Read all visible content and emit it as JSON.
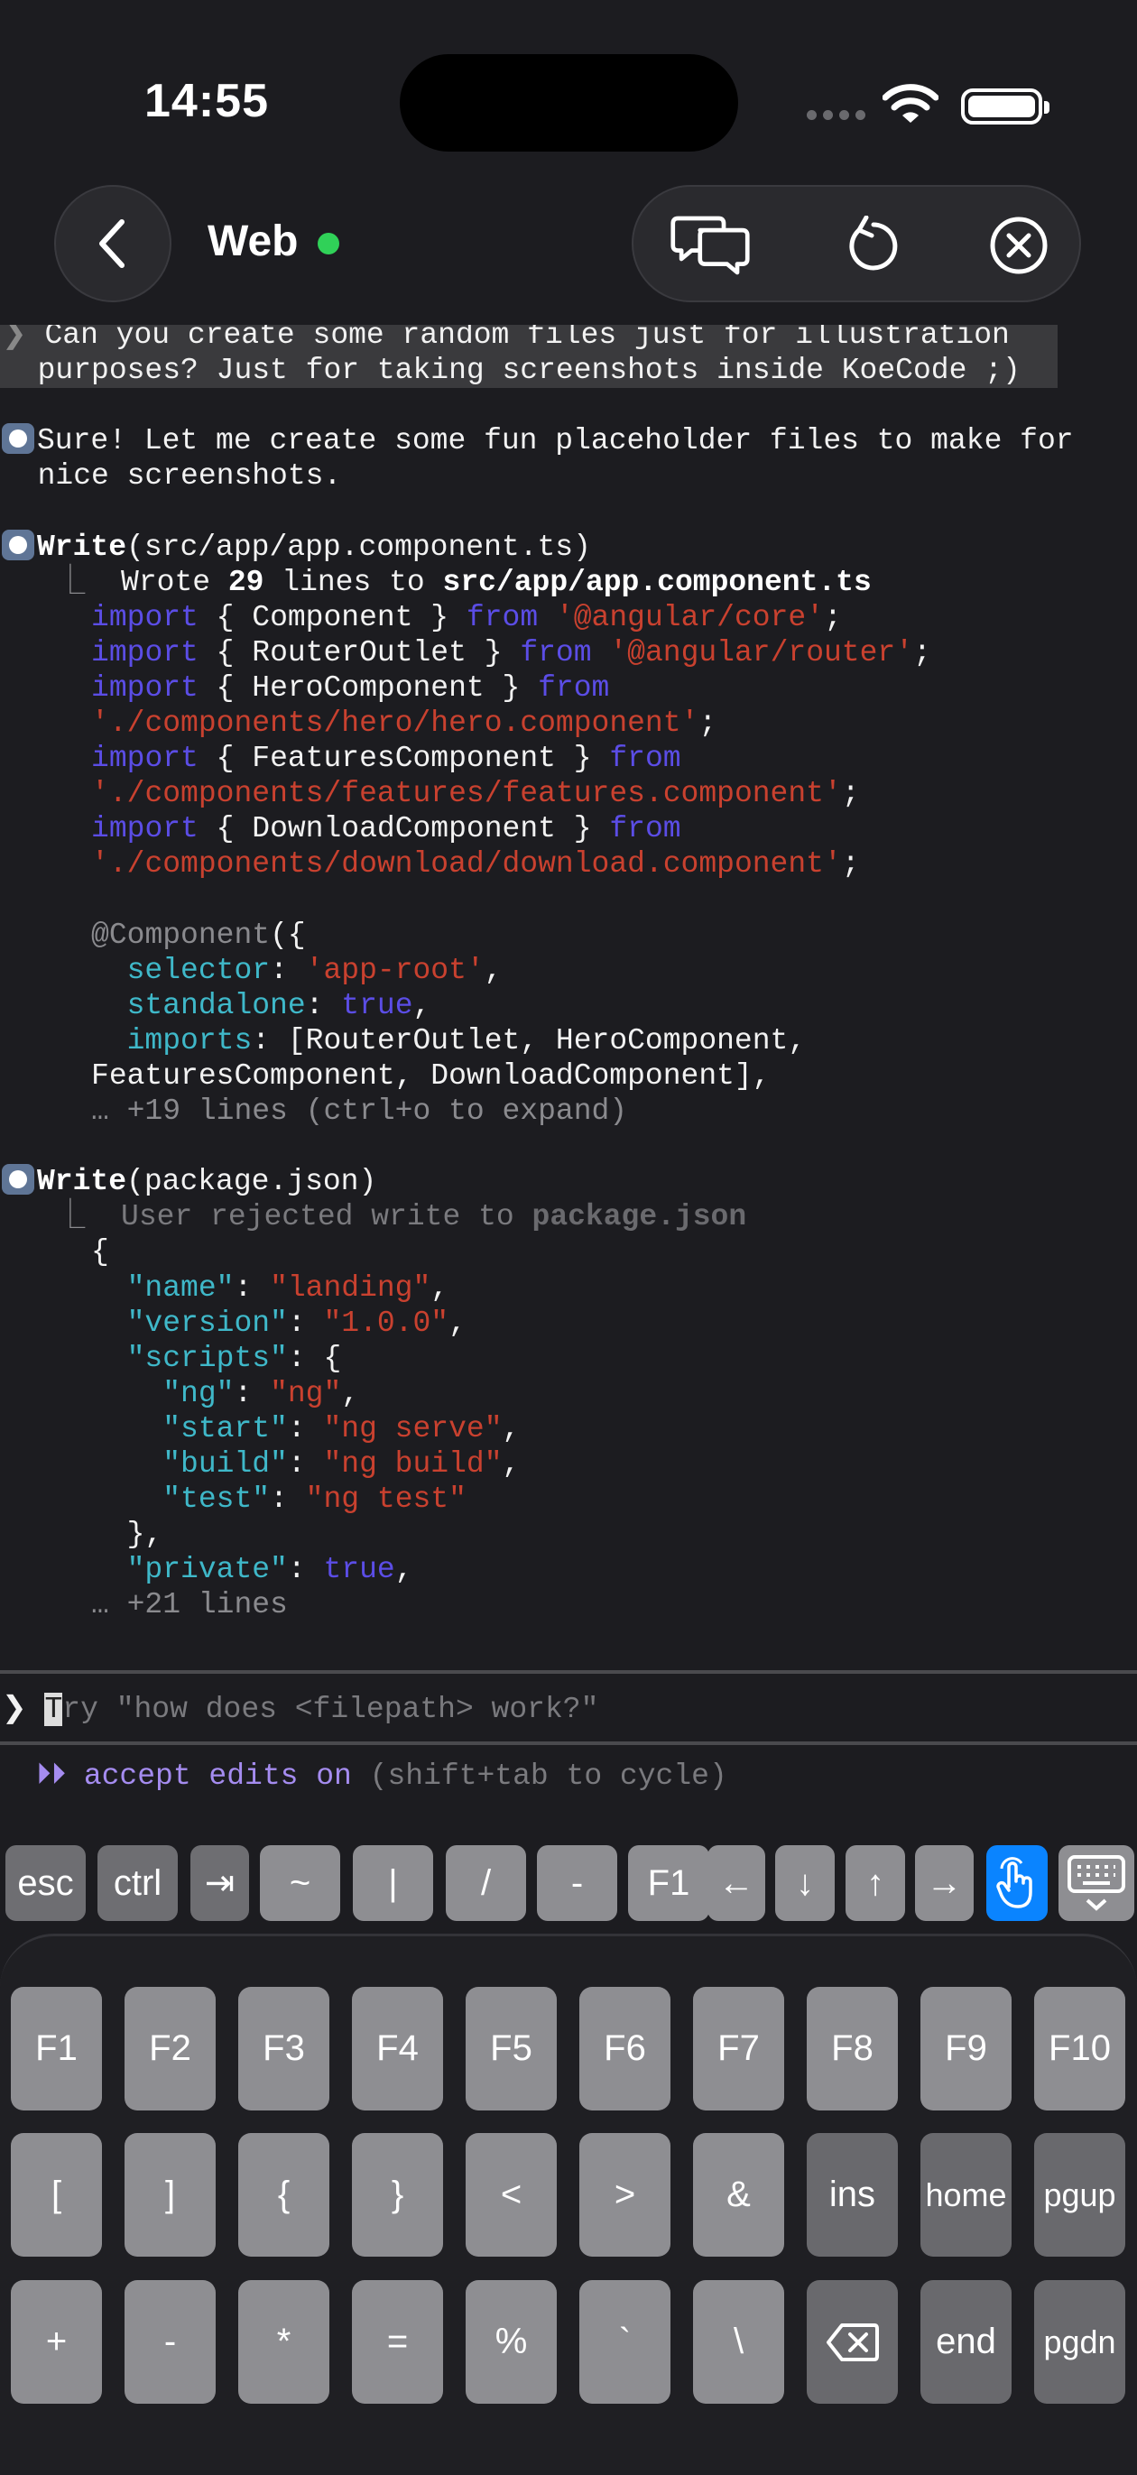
{
  "status": {
    "time": "14:55"
  },
  "nav": {
    "title": "Web",
    "online_color": "#30d158",
    "icons": [
      "back-icon",
      "chat-icon",
      "refresh-icon",
      "close-circle-icon"
    ]
  },
  "terminal": {
    "lines": [
      {
        "hl": true,
        "s": [
          [
            "arrow",
            "❯ "
          ],
          [
            "t",
            "Can you create some random files just for illustration"
          ]
        ]
      },
      {
        "hl": true,
        "s": [
          [
            "t",
            "  purposes? Just for taking screenshots inside KoeCode ;)"
          ]
        ]
      },
      {
        "s": []
      },
      {
        "bullet": true,
        "s": [
          [
            "t",
            "Sure! Let me create some fun placeholder files to make for"
          ]
        ]
      },
      {
        "s": [
          [
            "t",
            "  nice screenshots."
          ]
        ]
      },
      {
        "s": []
      },
      {
        "bullet": true,
        "s": [
          [
            "b",
            "Write"
          ],
          [
            "t",
            "(src/app/app.component.ts)"
          ]
        ]
      },
      {
        "s": [
          [
            "gray",
            "   ⎿  "
          ],
          [
            "t",
            "Wrote "
          ],
          [
            "b",
            "29"
          ],
          [
            "t",
            " lines to "
          ],
          [
            "b",
            "src/app/app.component.ts"
          ]
        ]
      },
      {
        "s": [
          [
            "t",
            "     "
          ],
          [
            "kw",
            "import"
          ],
          [
            "t",
            " { Component } "
          ],
          [
            "kw",
            "from"
          ],
          [
            "t",
            " "
          ],
          [
            "str",
            "'@angular/core'"
          ],
          [
            "t",
            ";"
          ]
        ]
      },
      {
        "s": [
          [
            "t",
            "     "
          ],
          [
            "kw",
            "import"
          ],
          [
            "t",
            " { RouterOutlet } "
          ],
          [
            "kw",
            "from"
          ],
          [
            "t",
            " "
          ],
          [
            "str",
            "'@angular/router'"
          ],
          [
            "t",
            ";"
          ]
        ]
      },
      {
        "s": [
          [
            "t",
            "     "
          ],
          [
            "kw",
            "import"
          ],
          [
            "t",
            " { HeroComponent } "
          ],
          [
            "kw",
            "from"
          ]
        ]
      },
      {
        "s": [
          [
            "t",
            "     "
          ],
          [
            "str",
            "'./components/hero/hero.component'"
          ],
          [
            "t",
            ";"
          ]
        ]
      },
      {
        "s": [
          [
            "t",
            "     "
          ],
          [
            "kw",
            "import"
          ],
          [
            "t",
            " { FeaturesComponent } "
          ],
          [
            "kw",
            "from"
          ]
        ]
      },
      {
        "s": [
          [
            "t",
            "     "
          ],
          [
            "str",
            "'./components/features/features.component'"
          ],
          [
            "t",
            ";"
          ]
        ]
      },
      {
        "s": [
          [
            "t",
            "     "
          ],
          [
            "kw",
            "import"
          ],
          [
            "t",
            " { DownloadComponent } "
          ],
          [
            "kw",
            "from"
          ]
        ]
      },
      {
        "s": [
          [
            "t",
            "     "
          ],
          [
            "str",
            "'./components/download/download.component'"
          ],
          [
            "t",
            ";"
          ]
        ]
      },
      {
        "s": []
      },
      {
        "s": [
          [
            "t",
            "     "
          ],
          [
            "gray",
            "@Component"
          ],
          [
            "t",
            "({"
          ]
        ]
      },
      {
        "s": [
          [
            "t",
            "       "
          ],
          [
            "key",
            "selector"
          ],
          [
            "t",
            ": "
          ],
          [
            "str",
            "'app-root'"
          ],
          [
            "t",
            ","
          ]
        ]
      },
      {
        "s": [
          [
            "t",
            "       "
          ],
          [
            "key",
            "standalone"
          ],
          [
            "t",
            ": "
          ],
          [
            "kw",
            "true"
          ],
          [
            "t",
            ","
          ]
        ]
      },
      {
        "s": [
          [
            "t",
            "       "
          ],
          [
            "key",
            "imports"
          ],
          [
            "t",
            ": [RouterOutlet, HeroComponent,"
          ]
        ]
      },
      {
        "s": [
          [
            "t",
            "     FeaturesComponent, DownloadComponent],"
          ]
        ]
      },
      {
        "s": [
          [
            "gray",
            "     … +19 lines (ctrl+o to expand)"
          ]
        ]
      },
      {
        "s": []
      },
      {
        "bullet": true,
        "s": [
          [
            "b",
            "Write"
          ],
          [
            "t",
            "(package.json)"
          ]
        ]
      },
      {
        "s": [
          [
            "gray",
            "   ⎿  "
          ],
          [
            "dim",
            "User rejected write to "
          ],
          [
            "bdim",
            "package.json"
          ]
        ]
      },
      {
        "s": [
          [
            "t",
            "     {"
          ]
        ]
      },
      {
        "s": [
          [
            "t",
            "       "
          ],
          [
            "key",
            "\"name\""
          ],
          [
            "t",
            ": "
          ],
          [
            "str",
            "\"landing\""
          ],
          [
            "t",
            ","
          ]
        ]
      },
      {
        "s": [
          [
            "t",
            "       "
          ],
          [
            "key",
            "\"version\""
          ],
          [
            "t",
            ": "
          ],
          [
            "str",
            "\"1.0.0\""
          ],
          [
            "t",
            ","
          ]
        ]
      },
      {
        "s": [
          [
            "t",
            "       "
          ],
          [
            "key",
            "\"scripts\""
          ],
          [
            "t",
            ": {"
          ]
        ]
      },
      {
        "s": [
          [
            "t",
            "         "
          ],
          [
            "key",
            "\"ng\""
          ],
          [
            "t",
            ": "
          ],
          [
            "str",
            "\"ng\""
          ],
          [
            "t",
            ","
          ]
        ]
      },
      {
        "s": [
          [
            "t",
            "         "
          ],
          [
            "key",
            "\"start\""
          ],
          [
            "t",
            ": "
          ],
          [
            "str",
            "\"ng serve\""
          ],
          [
            "t",
            ","
          ]
        ]
      },
      {
        "s": [
          [
            "t",
            "         "
          ],
          [
            "key",
            "\"build\""
          ],
          [
            "t",
            ": "
          ],
          [
            "str",
            "\"ng build\""
          ],
          [
            "t",
            ","
          ]
        ]
      },
      {
        "s": [
          [
            "t",
            "         "
          ],
          [
            "key",
            "\"test\""
          ],
          [
            "t",
            ": "
          ],
          [
            "str",
            "\"ng test\""
          ]
        ]
      },
      {
        "s": [
          [
            "t",
            "       },"
          ]
        ]
      },
      {
        "s": [
          [
            "t",
            "       "
          ],
          [
            "key",
            "\"private\""
          ],
          [
            "t",
            ": "
          ],
          [
            "kw",
            "true"
          ],
          [
            "t",
            ","
          ]
        ]
      },
      {
        "s": [
          [
            "gray",
            "     … +21 lines"
          ]
        ]
      }
    ]
  },
  "input": {
    "prompt": "❯ ",
    "cursor_char": "T",
    "placeholder_rest": "ry \"how does <filepath> work?\""
  },
  "mode": {
    "arrows": "⏵⏵ ",
    "label": "accept edits on",
    "hint": " (shift+tab to cycle)"
  },
  "accessory_keys": [
    "esc",
    "ctrl",
    "⇥",
    "~",
    "|",
    "/",
    "-",
    "F1",
    "←",
    "↓",
    "↑",
    "→",
    "touch-icon",
    "keyboard-hide-icon"
  ],
  "accent": "#0a84ff",
  "keyboard": {
    "rows": [
      [
        "F1",
        "F2",
        "F3",
        "F4",
        "F5",
        "F6",
        "F7",
        "F8",
        "F9",
        "F10"
      ],
      [
        "[",
        "]",
        "{",
        "}",
        "<",
        ">",
        "&",
        "ins",
        "home",
        "pgup"
      ],
      [
        "+",
        "-",
        "*",
        "=",
        "%",
        "`",
        "\\",
        "backspace-icon",
        "end",
        "pgdn"
      ]
    ]
  }
}
